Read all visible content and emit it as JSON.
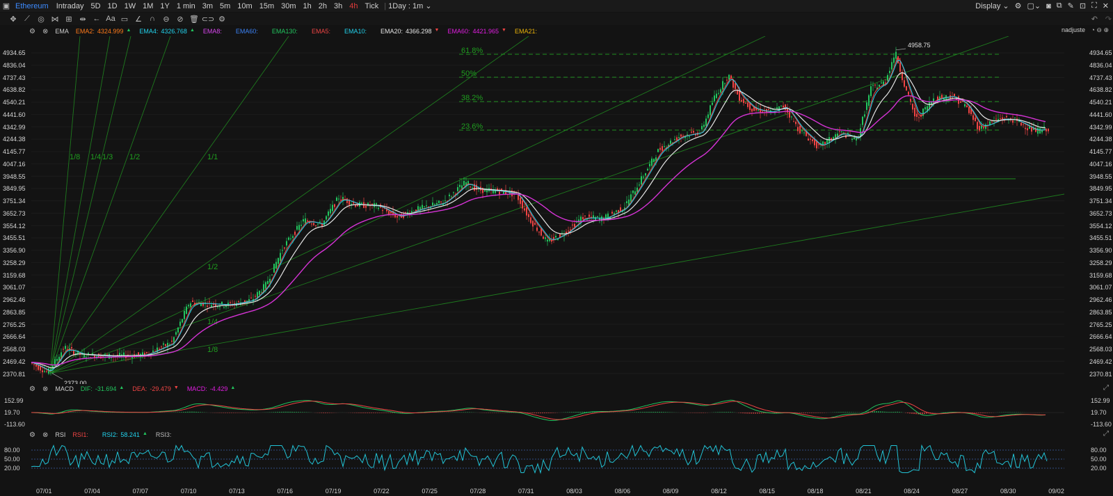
{
  "topbar": {
    "symbol": "Ethereum",
    "timeframes": [
      "Intraday",
      "5D",
      "1D",
      "1W",
      "1M",
      "1Y",
      "1 min",
      "3m",
      "5m",
      "10m",
      "15m",
      "30m",
      "1h",
      "2h",
      "3h",
      "4h",
      "Tick"
    ],
    "active_timeframe": "4h",
    "range_select": "1Day : 1m",
    "display_label": "Display"
  },
  "main_indicator": {
    "name": "EMA",
    "items": [
      {
        "label": "EMA2:",
        "value": "4324.999",
        "color": "#ff7a1a",
        "arrow": "▲"
      },
      {
        "label": "EMA4:",
        "value": "4326.768",
        "color": "#22d3ee",
        "arrow": "▲"
      },
      {
        "label": "EMA8:",
        "value": "",
        "color": "#d946ef",
        "arrow": ""
      },
      {
        "label": "EMA60:",
        "value": "",
        "color": "#3b82f6",
        "arrow": ""
      },
      {
        "label": "EMA130:",
        "value": "",
        "color": "#22c55e",
        "arrow": ""
      },
      {
        "label": "EMA5:",
        "value": "",
        "color": "#ef4444",
        "arrow": ""
      },
      {
        "label": "EMA10:",
        "value": "",
        "color": "#22d3ee",
        "arrow": ""
      },
      {
        "label": "EMA20:",
        "value": "4366.298",
        "color": "#e5e5e5",
        "arrow": "▼"
      },
      {
        "label": "EMA60:",
        "value": "4421.965",
        "color": "#e11ee1",
        "arrow": "▼"
      },
      {
        "label": "EMA21:",
        "value": "",
        "color": "#eab308",
        "arrow": ""
      }
    ],
    "user": "nadjuste"
  },
  "price_axis": [
    "4934.65",
    "4836.04",
    "4737.43",
    "4638.82",
    "4540.21",
    "4441.60",
    "4342.99",
    "4244.38",
    "4145.77",
    "4047.16",
    "3948.55",
    "3849.95",
    "3751.34",
    "3652.73",
    "3554.12",
    "3455.51",
    "3356.90",
    "3258.29",
    "3159.68",
    "3061.07",
    "2962.46",
    "2863.85",
    "2765.25",
    "2666.64",
    "2568.03",
    "2469.42",
    "2370.81"
  ],
  "annotations": {
    "high": "4958.75",
    "low": "2373.00",
    "fib_levels": [
      "61.8%",
      "50%",
      "38.2%",
      "23.6%"
    ],
    "gann_top": [
      "1/8",
      "1/4",
      "1/3",
      "1/2",
      "1/1"
    ],
    "gann_bottom": [
      "1/2",
      "1/4",
      "1/8"
    ]
  },
  "macd": {
    "name": "MACD",
    "items": [
      {
        "label": "DIF:",
        "value": "-31.694",
        "color": "#22c55e",
        "arrow": "▲"
      },
      {
        "label": "DEA:",
        "value": "-29.479",
        "color": "#ef4444",
        "arrow": "▼"
      },
      {
        "label": "MACD:",
        "value": "-4.429",
        "color": "#e11ee1",
        "arrow": "▲"
      }
    ],
    "axis": [
      "152.99",
      "19.70",
      "-113.60"
    ]
  },
  "rsi": {
    "name": "RSI",
    "items": [
      {
        "label": "RSI1:",
        "value": "",
        "color": "#ef4444",
        "arrow": ""
      },
      {
        "label": "RSI2:",
        "value": "58.241",
        "color": "#22d3ee",
        "arrow": "▲"
      },
      {
        "label": "RSI3:",
        "value": "",
        "color": "#bbbbbb",
        "arrow": ""
      }
    ],
    "axis": [
      "80.00",
      "50.00",
      "20.00"
    ]
  },
  "date_axis": [
    "07/01",
    "07/04",
    "07/07",
    "07/10",
    "07/13",
    "07/16",
    "07/19",
    "07/22",
    "07/25",
    "07/28",
    "07/31",
    "08/03",
    "08/06",
    "08/09",
    "08/12",
    "08/15",
    "08/18",
    "08/21",
    "08/24",
    "08/27",
    "08/30",
    "09/02"
  ],
  "colors": {
    "up": "#22c55e",
    "down": "#ef4444",
    "ema20": "#e5e5e5",
    "ema60": "#d633d6",
    "ema_fast": "#22d3ee",
    "fib": "#1f9e1f",
    "rsi": "#22c3d6"
  }
}
